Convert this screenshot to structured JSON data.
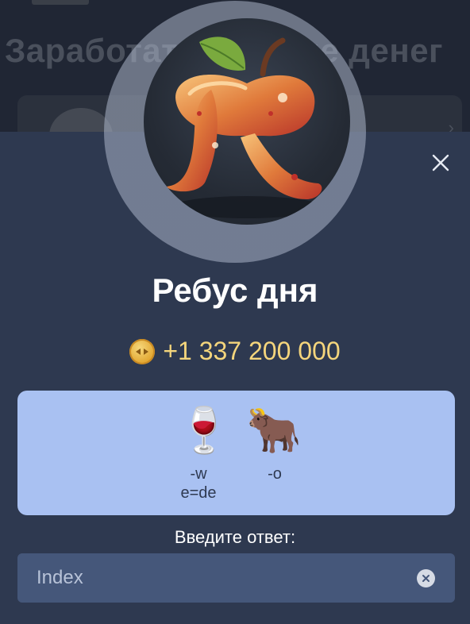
{
  "background": {
    "title": "Заработать больше денег"
  },
  "sheet": {
    "title": "Ребус дня",
    "reward_text": "+1 337 200 000",
    "puzzle": {
      "items": [
        {
          "icon": "wine-glass-icon",
          "glyph": "🍷",
          "hints": [
            "-w",
            "e=de"
          ]
        },
        {
          "icon": "ox-icon",
          "glyph": "🐂",
          "hints": [
            "-o"
          ]
        }
      ]
    },
    "answer_label": "Введите ответ:",
    "answer_placeholder": "Index"
  },
  "colors": {
    "sheet_bg": "#2e3950",
    "card_bg": "#a9c1f2",
    "reward": "#f4d57c",
    "input_bg": "#45577a"
  },
  "icons": {
    "close": "close-icon",
    "coin": "coin-icon",
    "clear": "clear-input-icon",
    "avatar": "apple-letter-r-logo"
  }
}
